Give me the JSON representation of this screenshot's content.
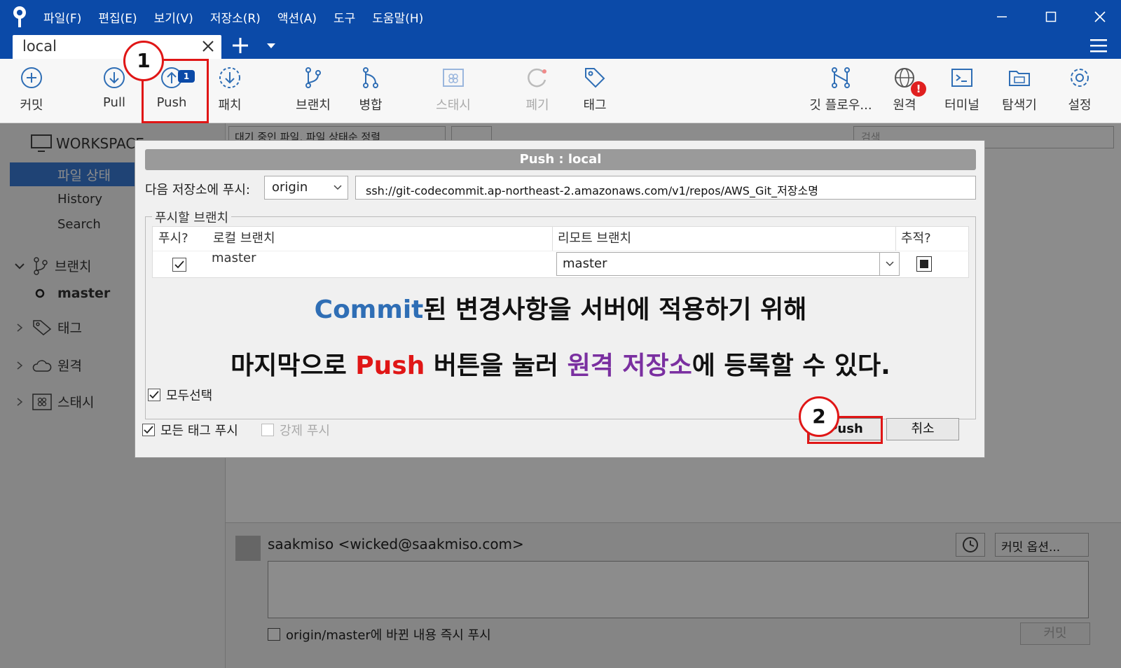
{
  "window": {
    "menu": [
      "파일(F)",
      "편집(E)",
      "보기(V)",
      "저장소(R)",
      "액션(A)",
      "도구",
      "도움말(H)"
    ],
    "tab": {
      "label": "local"
    }
  },
  "toolbar": {
    "commit": "커밋",
    "pull": "Pull",
    "push": "Push",
    "push_badge": "1",
    "fetch": "패치",
    "branch": "브랜치",
    "merge": "병합",
    "stash": "스태시",
    "discard": "폐기",
    "tag": "태그",
    "gitflow": "깃 플로우...",
    "remote": "원격",
    "terminal": "터미널",
    "explorer": "탐색기",
    "settings": "설정"
  },
  "sidebar": {
    "workspace": "WORKSPACE",
    "file_status": "파일 상태",
    "history": "History",
    "search": "Search",
    "branches": "브랜치",
    "current_branch": "master",
    "tags": "태그",
    "remotes": "원격",
    "stashes": "스태시"
  },
  "main": {
    "filter": "대기 중인 파일, 파일 상태순 정렬",
    "search_placeholder": "검색",
    "author": "saakmiso <wicked@saakmiso.com>",
    "commit_options": "커밋 옵션...",
    "push_now": "origin/master에 바뀐 내용 즉시 푸시",
    "commit_button": "커밋"
  },
  "dialog": {
    "title": "Push :  local",
    "repo_label": "다음 저장소에 푸시:",
    "repo_value": "origin",
    "repo_url": "ssh://git-codecommit.ap-northeast-2.amazonaws.com/v1/repos/AWS_Git_저장소명",
    "group_label": "푸시할 브랜치",
    "columns": {
      "push": "푸시?",
      "local": "로컬 브랜치",
      "remote": "리모트 브랜치",
      "track": "추적?"
    },
    "row": {
      "local": "master",
      "remote": "master"
    },
    "select_all": "모두선택",
    "push_all_tags": "모든 태그 푸시",
    "force_push": "강제 푸시",
    "push_button": "Push",
    "cancel_button": "취소"
  },
  "annotation": {
    "line1_kw": "Commit",
    "line1_rest": "된 변경사항을 서버에 적용하기 위해",
    "line2_a": "마지막으로 ",
    "line2_kw1": "Push",
    "line2_b": " 버튼을 눌러 ",
    "line2_kw2": "원격 저장소",
    "line2_c": "에 등록할 수 있다.",
    "step1": "1",
    "step2": "2"
  },
  "colors": {
    "titlebar": "#0b4aa8",
    "highlight": "#e01616",
    "keyword_blue": "#2f6eb5",
    "keyword_purple": "#7a2fa0"
  }
}
